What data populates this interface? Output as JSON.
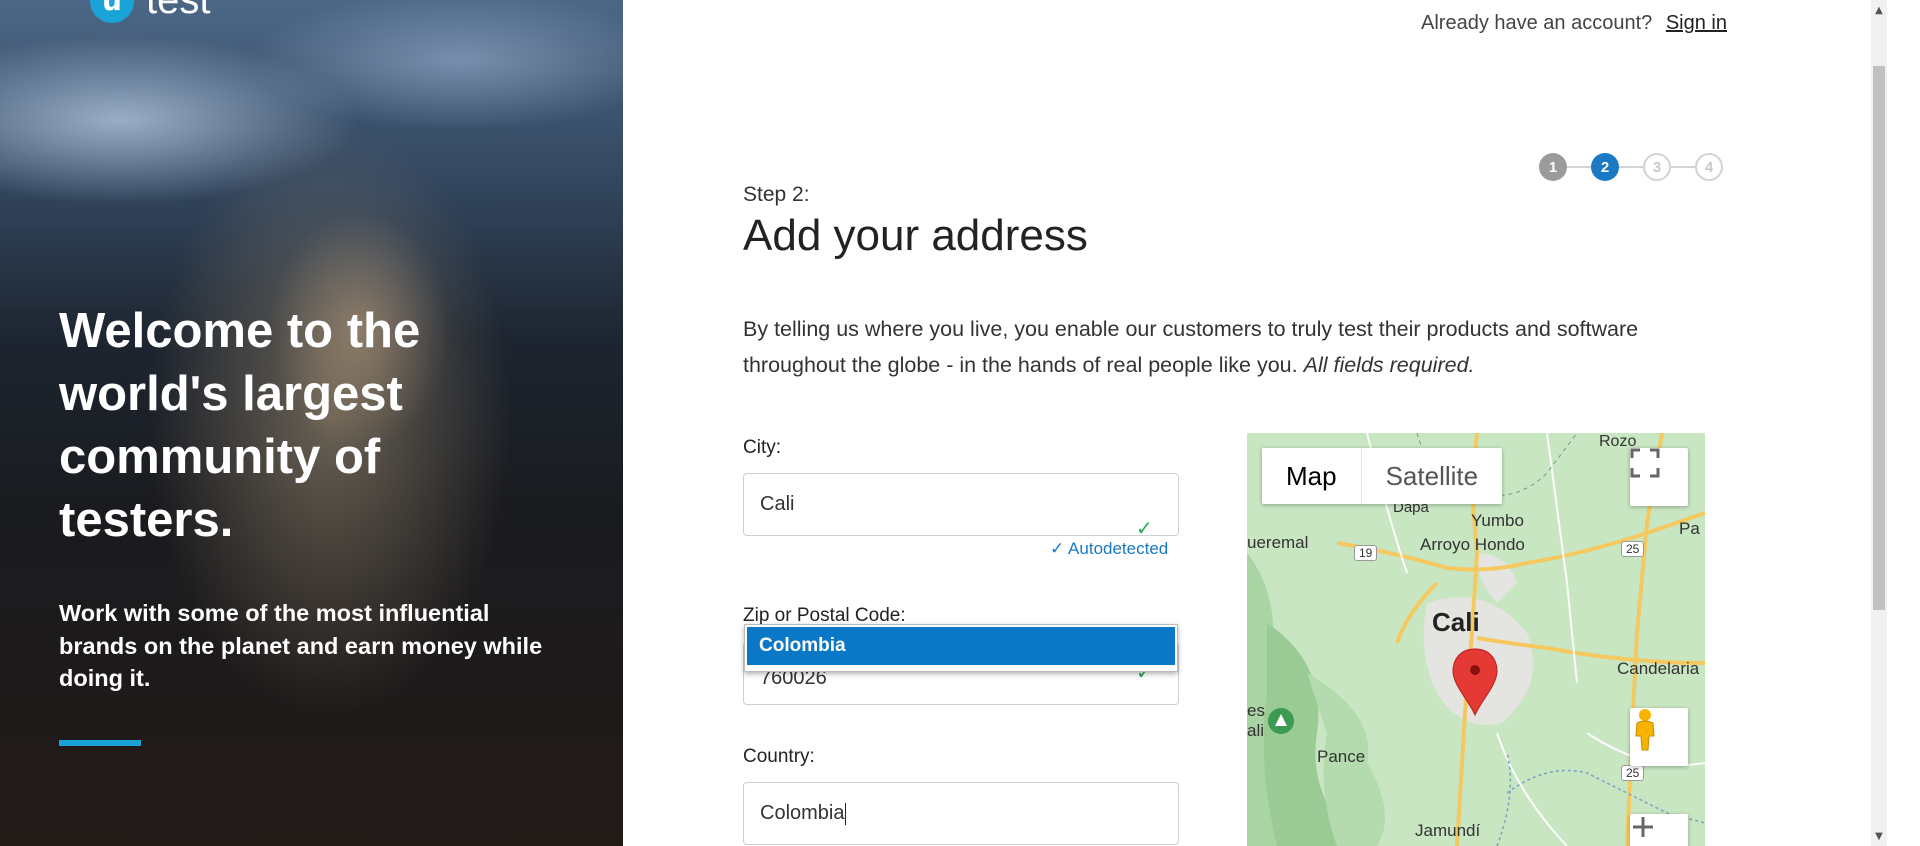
{
  "hero": {
    "logo_mark": "u",
    "logo_text": "test",
    "headline": "Welcome to the world's largest community of testers.",
    "subtext": "Work with some of the most influential brands on the planet and earn money while doing it."
  },
  "header": {
    "already_text": "Already have an account?",
    "signin_label": "Sign in"
  },
  "stepper": {
    "steps": [
      "1",
      "2",
      "3",
      "4"
    ],
    "current": 2
  },
  "form": {
    "step_label": "Step 2:",
    "title": "Add your address",
    "intro": "By telling us where you live, you enable our customers to truly test their products and software throughout the globe - in the hands of real people like you.",
    "intro_emphasis": "All fields required.",
    "city_label": "City:",
    "city_value": "Cali",
    "autodetected": "Autodetected",
    "zip_label": "Zip or Postal Code:",
    "zip_value": "760026",
    "country_label": "Country:",
    "country_value": "Colombia",
    "dropdown_option": "Colombia"
  },
  "map": {
    "type_map": "Map",
    "type_satellite": "Satellite",
    "labels": {
      "rozo": "Rozo",
      "dapa": "Dapa",
      "yumbo": "Yumbo",
      "pa": "Pa",
      "queremal": "ueremal",
      "arroyo": "Arroyo Hondo",
      "cali": "Cali",
      "candelaria": "Candelaria",
      "es": "es",
      "ali": "ali",
      "pance": "Pance",
      "jamundi": "Jamundí",
      "r19": "19",
      "r25a": "25",
      "r25b": "25"
    }
  },
  "colors": {
    "accent": "#1aa3d7",
    "primary": "#1a79c5",
    "check": "#2ea85b"
  }
}
